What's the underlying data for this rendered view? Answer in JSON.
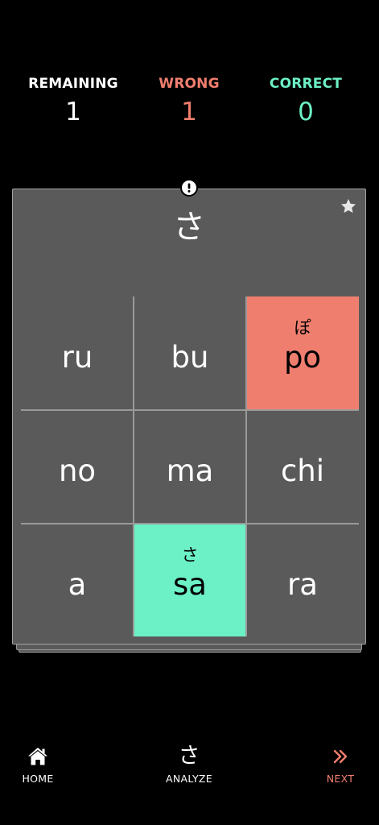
{
  "stats": {
    "remaining": {
      "label": "REMAINING",
      "value": "1"
    },
    "wrong": {
      "label": "WRONG",
      "value": "1"
    },
    "correct": {
      "label": "CORRECT",
      "value": "0"
    }
  },
  "card": {
    "prompt_kana": "さ",
    "alert_icon": "exclamation-circle-icon",
    "favorite_icon": "star-icon",
    "cells": [
      {
        "romaji": "ru",
        "kana": "",
        "state": "default"
      },
      {
        "romaji": "bu",
        "kana": "",
        "state": "default"
      },
      {
        "romaji": "po",
        "kana": "ぽ",
        "state": "wrong"
      },
      {
        "romaji": "no",
        "kana": "",
        "state": "default"
      },
      {
        "romaji": "ma",
        "kana": "",
        "state": "default"
      },
      {
        "romaji": "chi",
        "kana": "",
        "state": "default"
      },
      {
        "romaji": "a",
        "kana": "",
        "state": "default"
      },
      {
        "romaji": "sa",
        "kana": "さ",
        "state": "correct"
      },
      {
        "romaji": "ra",
        "kana": "",
        "state": "default"
      }
    ]
  },
  "nav": {
    "home": {
      "label": "HOME",
      "icon": "home-icon"
    },
    "analyze": {
      "label": "ANALYZE",
      "glyph": "さ"
    },
    "next": {
      "label": "NEXT",
      "icon": "double-chevron-right-icon"
    }
  },
  "colors": {
    "background": "#000000",
    "card": "#5a5a5a",
    "wrong": "#f07e6e",
    "correct": "#6cf0c6",
    "text": "#ffffff"
  }
}
